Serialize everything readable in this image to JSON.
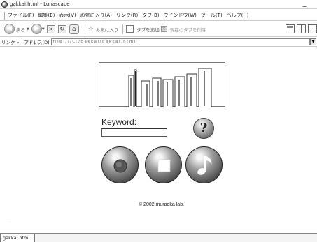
{
  "window": {
    "title": "gakkai.html - Lunascape",
    "controls": [
      "_",
      " ",
      " "
    ]
  },
  "menu": {
    "items": [
      "ファイル(F)",
      "編集(E)",
      "表示(V)",
      "お気に入り(A)",
      "リンク(R)",
      "タブ(B)",
      "ウインドウ(W)",
      "ツール(T)",
      "ヘルプ(H)"
    ]
  },
  "toolbar": {
    "back_label": "戻る",
    "favorites_label": "お気に入り",
    "add_tab_label": "タブを追加",
    "close_tab_label": "現在のタブを削除"
  },
  "address": {
    "links_label": "リンク »",
    "label": "アドレス(D)",
    "value": "file:///C:/gakkai/gakkai.html"
  },
  "page": {
    "keyword_label": "Keyword:",
    "keyword_value": "",
    "help_glyph": "?",
    "copyright": "© 2002 muraoka lab."
  },
  "tabs": [
    {
      "label": "gakkai.html"
    }
  ],
  "colors": {
    "background": "#ffffff",
    "button_gray": "#5e5e5e"
  },
  "icons": {
    "play": "play-circle-icon",
    "stop": "stop-square-icon",
    "music": "music-note-icon",
    "help": "question-mark-icon"
  }
}
